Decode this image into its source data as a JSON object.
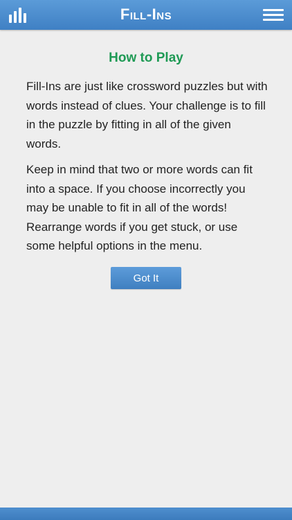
{
  "header": {
    "title": "Fill-Ins",
    "stats_icon": "bar-chart-icon",
    "menu_icon": "hamburger-menu-icon"
  },
  "how_to_play": {
    "heading": "How to Play",
    "paragraph_1": "Fill-Ins are just like crossword puzzles but with words instead of clues. Your challenge is to fill in the puzzle by fitting in all of the given words.",
    "paragraph_2": "Keep in mind that two or more words can fit into a space. If you choose incorrectly you may be unable to fit in all of the words! Rearrange words if you get stuck, or use some helpful options in the menu.",
    "button_label": "Got It"
  },
  "colors": {
    "header_blue": "#4a8cce",
    "heading_green": "#1f9a55",
    "background": "#eeeeee"
  }
}
